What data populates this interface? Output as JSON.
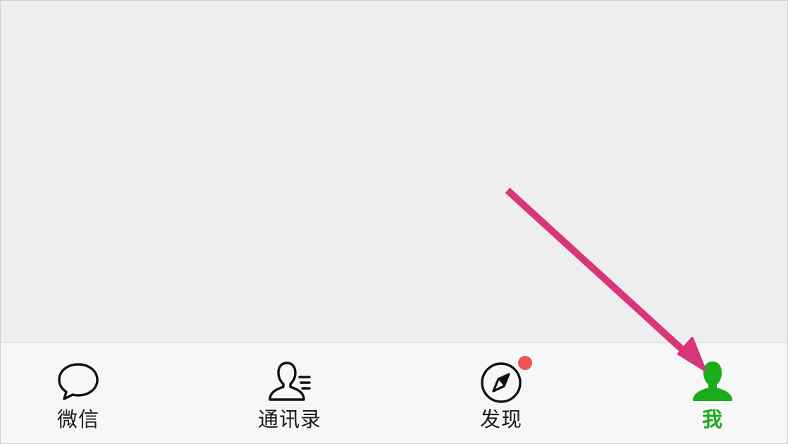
{
  "tab_bar": {
    "tabs": [
      {
        "label": "微信",
        "icon": "chat-bubble-icon",
        "active": false
      },
      {
        "label": "通讯录",
        "icon": "contacts-icon",
        "active": false
      },
      {
        "label": "发现",
        "icon": "compass-icon",
        "active": false,
        "badge": "dot"
      },
      {
        "label": "我",
        "icon": "person-icon",
        "active": true
      }
    ]
  },
  "colors": {
    "active_tab": "#1aad19",
    "badge": "#f05352",
    "annotation_arrow": "#d9367a",
    "content_background": "#efeeef",
    "tab_bar_background": "#f7f7f7"
  }
}
